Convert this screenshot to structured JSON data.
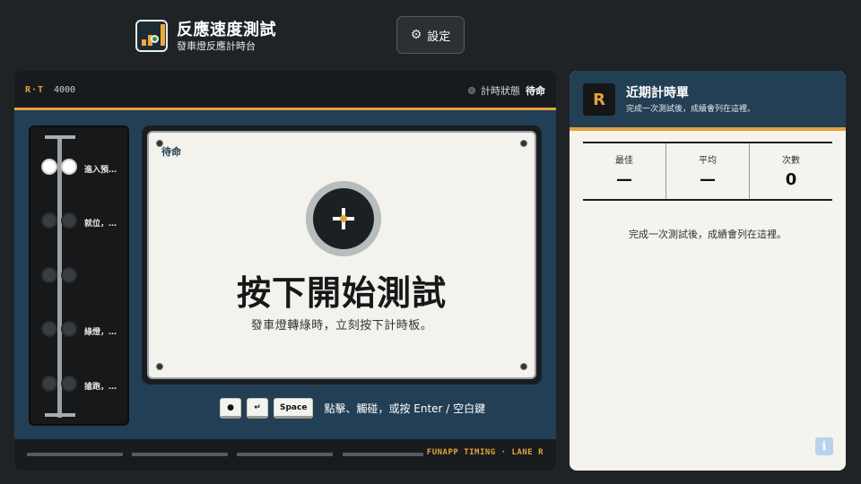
{
  "header": {
    "title": "反應速度測試",
    "subtitle": "發車燈反應計時台",
    "settings_label": "設定"
  },
  "console": {
    "brand": "R·T",
    "model": "4000",
    "status_label": "計時狀態",
    "status_value": "待命",
    "lights": [
      {
        "label": "進入預…",
        "lit": true
      },
      {
        "label": "就位，…",
        "lit": false
      },
      {
        "label": "",
        "lit": false
      },
      {
        "label": "綠燈，…",
        "lit": false
      },
      {
        "label": "搶跑，…",
        "lit": false
      }
    ],
    "pad": {
      "state": "待命",
      "title": "按下開始測試",
      "hint": "發車燈轉綠時，立刻按下計時板。"
    },
    "keys": [
      "●",
      "↵",
      "Space"
    ],
    "keys_hint": "點擊、觸碰，或按 Enter / 空白鍵",
    "footer": "FUNAPP TIMING · LANE R"
  },
  "history": {
    "badge": "R",
    "title": "近期計時單",
    "subtitle": "完成一次測試後，成績會列在這裡。",
    "stats": [
      {
        "label": "最佳",
        "value": "—"
      },
      {
        "label": "平均",
        "value": "—"
      },
      {
        "label": "次數",
        "value": "0"
      }
    ],
    "empty_message": "完成一次測試後，成績會列在這裡。",
    "info_label": "i"
  },
  "colors": {
    "accent": "#e3a23d",
    "panel_blue": "#233f55",
    "background": "#1f2326"
  },
  "icons": {
    "settings": "gear-icon",
    "target": "crosshair-icon",
    "info": "info-icon"
  }
}
